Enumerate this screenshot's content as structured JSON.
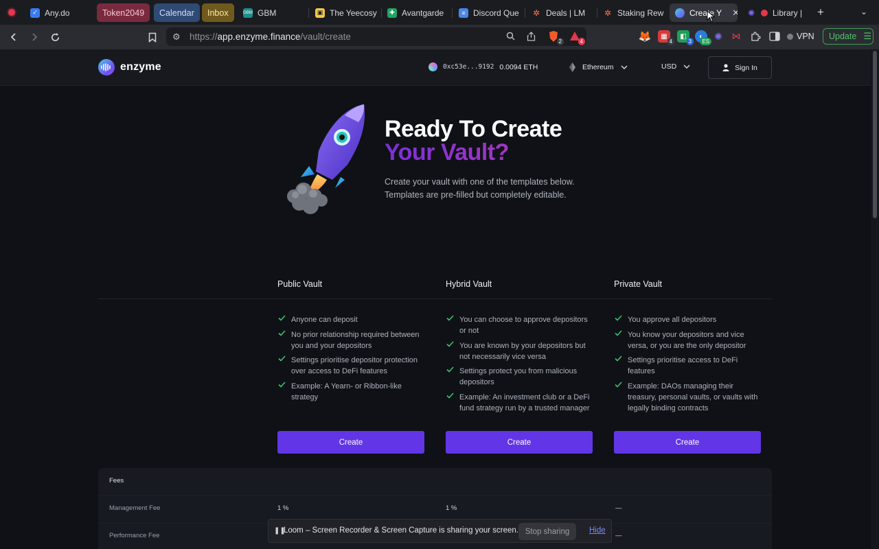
{
  "browser": {
    "tabs": [
      {
        "label": "Any.do",
        "icon": "anydo-icon",
        "color": "#3a7cf0"
      },
      {
        "label": "Token2049",
        "group_color": "#7a2a3f"
      },
      {
        "label": "Calendar",
        "group_color": "#2f4a73"
      },
      {
        "label": "Inbox",
        "group_color": "#6e5a1c"
      },
      {
        "label": "GBM",
        "icon": "gbm-icon",
        "color": "#1f8e8a"
      },
      {
        "label": "The Yeecosy",
        "icon": "notion-icon",
        "color": "#f2c744"
      },
      {
        "label": "Avantgarde",
        "icon": "sheets-icon",
        "color": "#1fa463"
      },
      {
        "label": "Discord Que",
        "icon": "docs-icon",
        "color": "#4a86e8"
      },
      {
        "label": "Deals | LM",
        "icon": "hubspot-icon",
        "color": "#ff7a59"
      },
      {
        "label": "Staking Rew",
        "icon": "hubspot-icon",
        "color": "#ff7a59"
      },
      {
        "label": "Create Y",
        "icon": "enzyme-icon",
        "color": "#6c4ff0"
      },
      {
        "label": "Library |",
        "icon": "loom-icon",
        "color": "#e2384d"
      }
    ],
    "url_prefix": "https://",
    "url_host": "app.enzyme.finance",
    "url_path": "/vault/create",
    "brave_badge": "2",
    "rewards_badge": "4",
    "ext_badges": [
      "4",
      "3",
      "ES"
    ],
    "vpn_label": "VPN",
    "update_label": "Update"
  },
  "header": {
    "logo_text": "enzyme",
    "wallet_address": "0xc53e...9192",
    "wallet_balance": "0.0094 ETH",
    "network": "Ethereum",
    "currency": "USD",
    "signin_label": "Sign In"
  },
  "hero": {
    "title_line1": "Ready To Create",
    "title_line2": "Your Vault?",
    "description": "Create your vault with one of the templates below. Templates are pre-filled but completely editable."
  },
  "vaults": [
    {
      "name": "Public Vault",
      "features": [
        "Anyone can deposit",
        "No prior relationship required between you and your depositors",
        "Settings prioritise depositor protection over access to DeFi features",
        "Example: A Yearn- or Ribbon-like strategy"
      ],
      "button": "Create"
    },
    {
      "name": "Hybrid Vault",
      "features": [
        "You can choose to approve depositors or not",
        "You are known by your depositors but not necessarily vice versa",
        "Settings protect you from malicious depositors",
        "Example: An investment club or a DeFi fund strategy run by a trusted manager"
      ],
      "button": "Create"
    },
    {
      "name": "Private Vault",
      "features": [
        "You approve all depositors",
        "You know your depositors and vice versa, or you are the only depositor",
        "Settings prioritise access to DeFi features",
        "Example: DAOs managing their treasury, personal vaults, or vaults with legally binding contracts"
      ],
      "button": "Create"
    }
  ],
  "fees": {
    "title": "Fees",
    "rows": [
      {
        "label": "Management Fee",
        "values": [
          "1 %",
          "1 %",
          "—"
        ]
      },
      {
        "label": "Performance Fee",
        "values": [
          "",
          "",
          "—"
        ]
      }
    ]
  },
  "loom": {
    "message": "Loom – Screen Recorder & Screen Capture is sharing your screen.",
    "stop_label": "Stop sharing",
    "hide_label": "Hide"
  },
  "colors": {
    "accent": "#6235e6",
    "check": "#3ec46d",
    "page_bg": "#0f1116"
  }
}
